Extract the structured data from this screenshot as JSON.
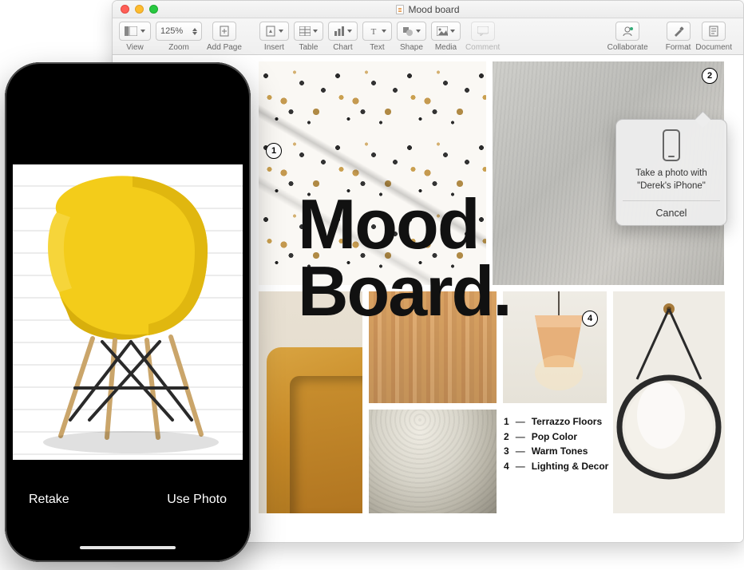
{
  "window": {
    "title": "Mood board",
    "traffic": {
      "close": true,
      "minimize": true,
      "zoom": true
    }
  },
  "toolbar": {
    "view": "View",
    "zoom_label": "Zoom",
    "zoom_value": "125%",
    "add_page": "Add Page",
    "insert": "Insert",
    "table": "Table",
    "chart": "Chart",
    "text": "Text",
    "shape": "Shape",
    "media": "Media",
    "comment": "Comment",
    "collaborate": "Collaborate",
    "format": "Format",
    "document": "Document"
  },
  "document": {
    "title_line1": "Mood",
    "title_line2": "Board.",
    "callouts": {
      "one": "1",
      "two": "2",
      "four": "4"
    },
    "legend": [
      {
        "n": "1",
        "label": "Terrazzo Floors"
      },
      {
        "n": "2",
        "label": "Pop Color"
      },
      {
        "n": "3",
        "label": "Warm Tones"
      },
      {
        "n": "4",
        "label": "Lighting & Decor"
      }
    ]
  },
  "popover": {
    "message_line1": "Take a photo with",
    "message_line2": "\"Derek's iPhone\"",
    "cancel": "Cancel"
  },
  "iphone": {
    "retake": "Retake",
    "use_photo": "Use Photo"
  }
}
